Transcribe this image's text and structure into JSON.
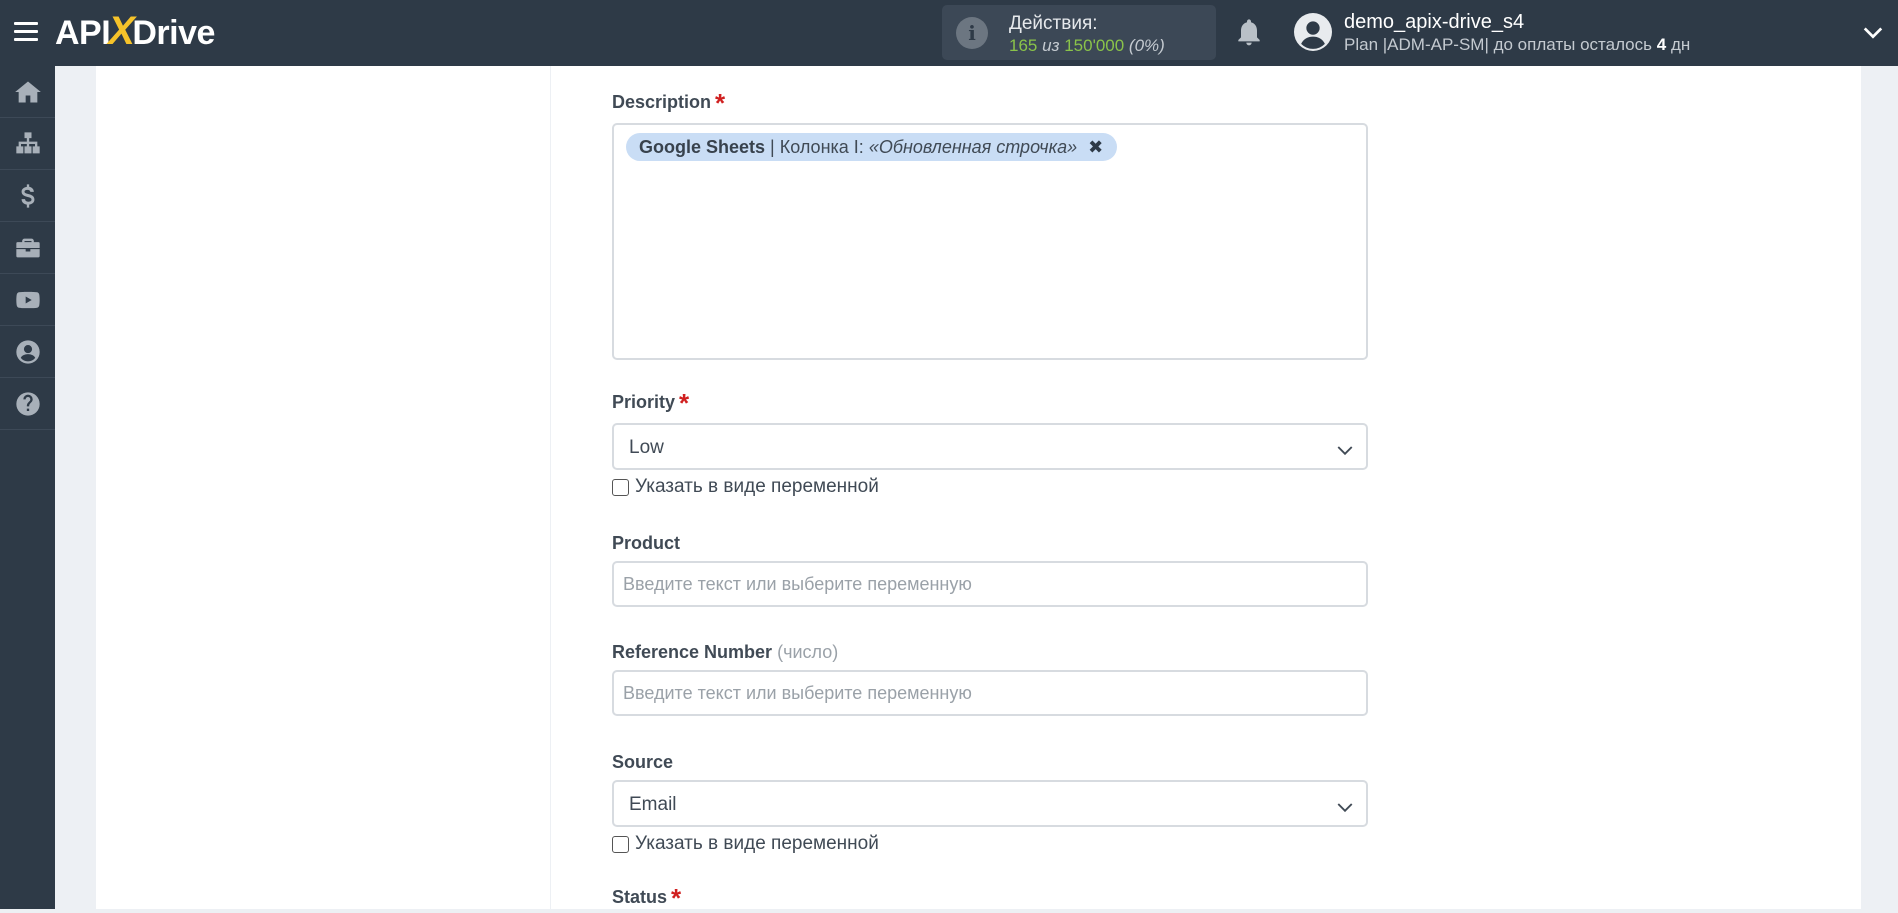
{
  "header": {
    "logo_left": "API",
    "logo_x": "X",
    "logo_right": "Drive",
    "actions_title": "Действия:",
    "actions_used": "165",
    "actions_of": "из",
    "actions_total": "150'000",
    "actions_percent": "(0%)",
    "user_name": "demo_apix-drive_s4",
    "plan_prefix": "Plan |ADM-AP-SM| до оплаты осталось",
    "plan_days": "4",
    "plan_suffix": "дн"
  },
  "sidebar": {
    "items": [
      "home-icon",
      "sitemap-icon",
      "dollar-icon",
      "briefcase-icon",
      "youtube-icon",
      "user-circle-icon",
      "question-circle-icon"
    ]
  },
  "form": {
    "description": {
      "label": "Description",
      "required_mark": "*",
      "tag_source": "Google Sheets",
      "tag_sep": "|",
      "tag_column": "Колонка I:",
      "tag_value": "«Обновленная строчка»",
      "tag_close": "✖"
    },
    "priority": {
      "label": "Priority",
      "required_mark": "*",
      "value": "Low",
      "checkbox_label": "Указать в виде переменной"
    },
    "product": {
      "label": "Product",
      "placeholder": "Введите текст или выберите переменную"
    },
    "reference_number": {
      "label": "Reference Number",
      "hint": "(число)",
      "placeholder": "Введите текст или выберите переменную"
    },
    "source": {
      "label": "Source",
      "value": "Email",
      "checkbox_label": "Указать в виде переменной"
    },
    "status": {
      "label": "Status",
      "required_mark": "*"
    }
  },
  "colors": {
    "topbar": "#2e3a47",
    "accent_yellow": "#f6c32a",
    "green": "#8ac34a",
    "required": "#d02020",
    "tag_bg": "#c9ddf5"
  }
}
